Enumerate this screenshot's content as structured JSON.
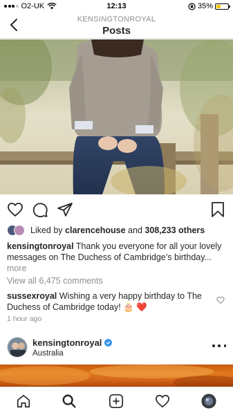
{
  "status_bar": {
    "carrier": "O2-UK",
    "time": "12:13",
    "battery": "35%",
    "battery_level": 0.35,
    "icons": [
      "signal-icon",
      "wifi-icon",
      "orientation-lock-icon",
      "battery-icon"
    ]
  },
  "header": {
    "account": "KENSINGTONROYAL",
    "title": "Posts",
    "back_icon": "chevron-left-icon"
  },
  "post": {
    "image_description_icon": "photo",
    "actions": {
      "icons": [
        "heart-icon",
        "comment-icon",
        "share-icon",
        "bookmark-icon"
      ]
    },
    "likes": {
      "prefix": "Liked by ",
      "user": "clarencehouse",
      "middle": " and ",
      "count": "308,233 others"
    },
    "caption": {
      "user": "kensingtonroyal",
      "text": " Thank you everyone for all your lovely messages on The Duchess of Cambridge’s birthday...",
      "more": " more"
    },
    "view_comments": "View all 6,475 comments",
    "comment": {
      "user": "sussexroyal",
      "text": " Wishing a very happy birthday to The Duchess of Cambridge today! 🎂 ❤️"
    },
    "timestamp": "1 hour ago"
  },
  "next_post": {
    "user": "kensingtonroyal",
    "location": "Australia",
    "verified_icon": "verified-badge-icon",
    "more_icon": "more-horizontal-icon"
  },
  "tab_bar": {
    "icons": [
      "home-icon",
      "search-icon",
      "new-post-icon",
      "activity-icon",
      "profile-avatar"
    ]
  },
  "colors": {
    "accent": "#3897f0",
    "battery": "#f5c400",
    "heart_emoji": "#e0245e",
    "muted_text": "#8e8e8e"
  }
}
